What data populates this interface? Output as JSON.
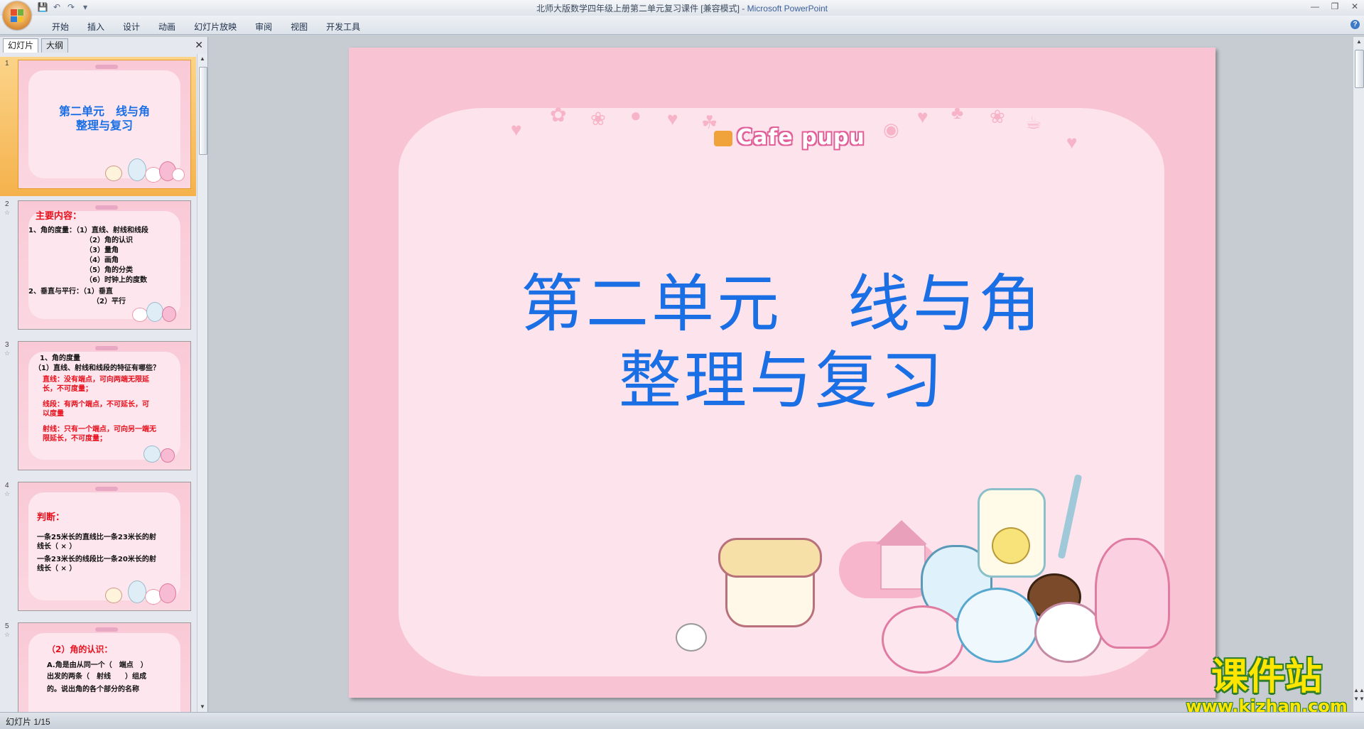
{
  "window": {
    "title": "北师大版数学四年级上册第二单元复习课件 [兼容模式] - ",
    "app_name": "Microsoft PowerPoint"
  },
  "quick_access": {
    "save_icon": "save-icon",
    "undo_icon": "undo-icon",
    "redo_icon": "redo-icon",
    "customize_icon": "dropdown-icon"
  },
  "ribbon": {
    "tabs": [
      "开始",
      "插入",
      "设计",
      "动画",
      "幻灯片放映",
      "审阅",
      "视图",
      "开发工具"
    ]
  },
  "left_pane": {
    "tabs": [
      "幻灯片",
      "大纲"
    ],
    "thumbnails": [
      {
        "num": "1",
        "lines": [
          "第二单元　线与角",
          "整理与复习"
        ]
      },
      {
        "num": "2",
        "heading": "主要内容：",
        "lines": [
          "1、角的度量：（1）直线、射线和线段",
          "（2）角的认识",
          "（3）量角",
          "（4）画角",
          "（5）角的分类",
          "（6）时钟上的度数",
          "2、垂直与平行：（1）垂直",
          "（2）平行"
        ]
      },
      {
        "num": "3",
        "lines": [
          "1、角的度量",
          "（1）直线、射线和线段的特征有哪些？",
          "直线：没有端点，可向两端无限延",
          "长，不可度量；",
          "线段：有两个端点，不可延长，可",
          "以度量",
          "射线：只有一个端点，可向另一端无",
          "限延长，不可度量；"
        ]
      },
      {
        "num": "4",
        "heading": "判断：",
        "lines": [
          "一条25米长的直线比一条23米长的射",
          "线长（ × ）",
          "一条23米长的线段比一条20米长的射",
          "线长（ × ）"
        ]
      },
      {
        "num": "5",
        "heading": "（2）角的认识：",
        "lines": [
          "A.角是由从同一个（　端点　）",
          "出发的两条（　射线　　）组成",
          "的。说出角的各个部分的名称"
        ]
      }
    ]
  },
  "slide": {
    "logo": "Cafe pupu",
    "title_line1": "第二单元　线与角",
    "title_line2": "整理与复习"
  },
  "watermark": {
    "main": "课件站",
    "url": "www.kjzhan.com"
  },
  "status": {
    "text": "幻灯片 1/15"
  }
}
